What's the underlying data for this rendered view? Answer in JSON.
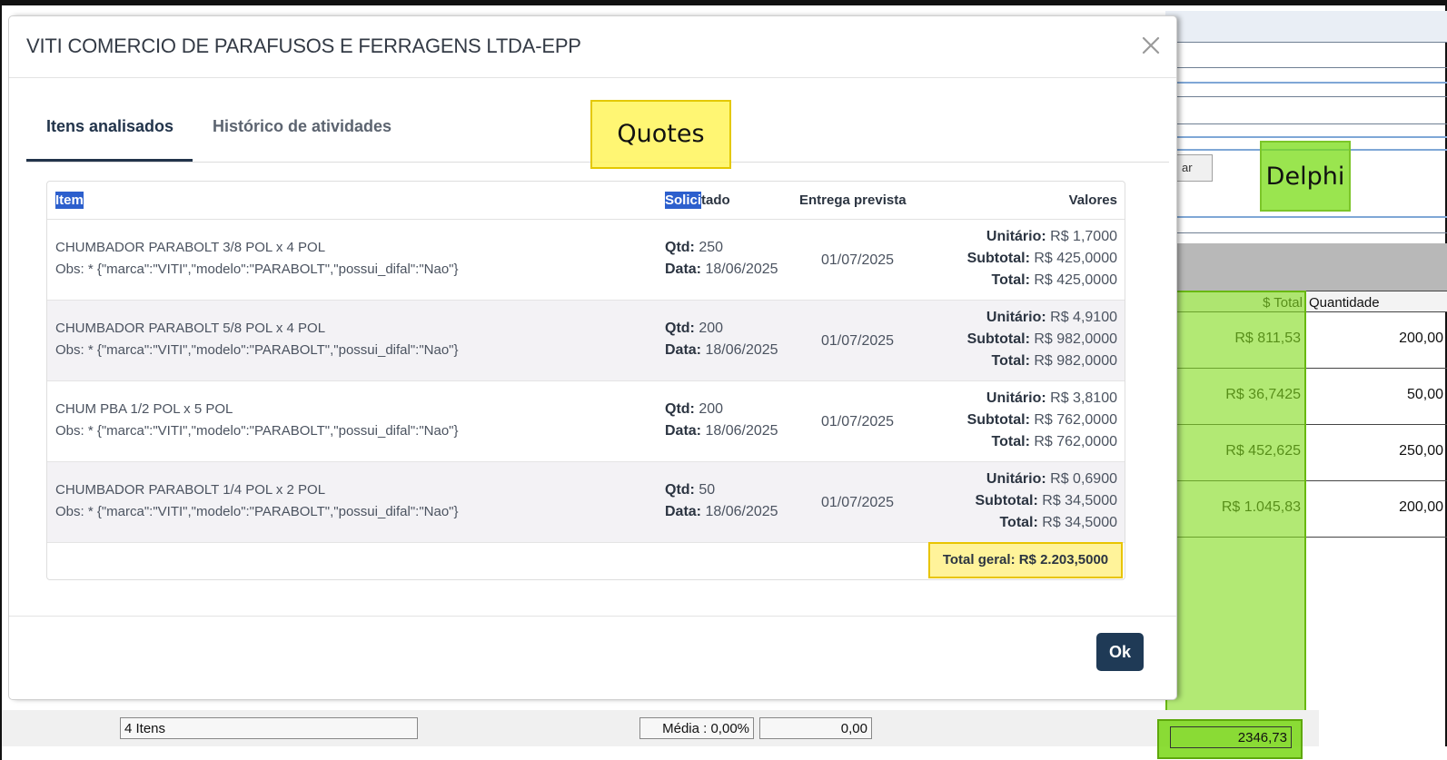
{
  "modal": {
    "title": "VITI COMERCIO DE PARAFUSOS E FERRAGENS LTDA-EPP",
    "tabs": [
      {
        "label": "Itens analisados",
        "active": true
      },
      {
        "label": "Histórico de atividades",
        "active": false
      }
    ],
    "table": {
      "headers": {
        "item_selected": "Item",
        "solicitado_selected": "Solici",
        "solicitado_rest": "tado",
        "entrega": "Entrega prevista",
        "valores": "Valores"
      },
      "rows": [
        {
          "name": "CHUMBADOR PARABOLT 3/8 POL x 4 POL",
          "obs": "Obs: * {\"marca\":\"VITI\",\"modelo\":\"PARABOLT\",\"possui_difal\":\"Nao\"}",
          "qtd": "250",
          "data": "18/06/2025",
          "entrega": "01/07/2025",
          "unitario": "R$ 1,7000",
          "subtotal": "R$ 425,0000",
          "total": "R$ 425,0000"
        },
        {
          "name": "CHUMBADOR PARABOLT 5/8 POL x 4 POL",
          "obs": "Obs: * {\"marca\":\"VITI\",\"modelo\":\"PARABOLT\",\"possui_difal\":\"Nao\"}",
          "qtd": "200",
          "data": "18/06/2025",
          "entrega": "01/07/2025",
          "unitario": "R$ 4,9100",
          "subtotal": "R$ 982,0000",
          "total": "R$ 982,0000"
        },
        {
          "name": "CHUM PBA 1/2 POL x 5 POL",
          "obs": "Obs: * {\"marca\":\"VITI\",\"modelo\":\"PARABOLT\",\"possui_difal\":\"Nao\"}",
          "qtd": "200",
          "data": "18/06/2025",
          "entrega": "01/07/2025",
          "unitario": "R$ 3,8100",
          "subtotal": "R$ 762,0000",
          "total": "R$ 762,0000"
        },
        {
          "name": "CHUMBADOR PARABOLT 1/4 POL x 2 POL",
          "obs": "Obs: * {\"marca\":\"VITI\",\"modelo\":\"PARABOLT\",\"possui_difal\":\"Nao\"}",
          "qtd": "50",
          "data": "18/06/2025",
          "entrega": "01/07/2025",
          "unitario": "R$ 0,6900",
          "subtotal": "R$ 34,5000",
          "total": "R$ 34,5000"
        }
      ],
      "labels": {
        "qtd": "Qtd:",
        "data": "Data:",
        "unitario": "Unitário:",
        "subtotal": "Subtotal:",
        "total": "Total:"
      },
      "total_geral": "Total geral: R$ 2.203,5000"
    },
    "ok_label": "Ok"
  },
  "annotations": {
    "quotes": "Quotes",
    "delphi": "Delphi"
  },
  "delphi": {
    "toolbar_button": "ar",
    "grid": {
      "headers": {
        "total": "$ Total",
        "quantidade": "Quantidade"
      },
      "rows": [
        {
          "total": "R$ 811,53",
          "quantidade": "200,00"
        },
        {
          "total": "R$ 36,7425",
          "quantidade": "50,00"
        },
        {
          "total": "R$ 452,625",
          "quantidade": "250,00"
        },
        {
          "total": "R$ 1.045,83",
          "quantidade": "200,00"
        }
      ]
    },
    "status": {
      "itens": "4 Itens",
      "media": "Média : 0,00%",
      "valor": "0,00",
      "total": "2346,73"
    }
  },
  "colors": {
    "primary": "#1f3a56",
    "highlight_yellow": "#fff39a",
    "highlight_green": "#82dc1e",
    "selection": "#2c5fcd"
  }
}
